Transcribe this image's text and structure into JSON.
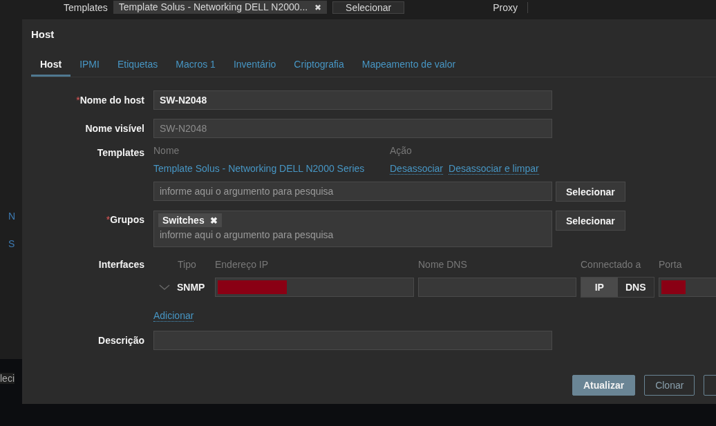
{
  "background": {
    "templates_label": "Templates",
    "template_tag": "Template Solus - Networking DELL N2000...",
    "tag_remove": "✖",
    "select_button": "Selecionar",
    "proxy_label": "Proxy",
    "fragments": [
      "N",
      "S",
      "leci"
    ]
  },
  "dialog": {
    "title": "Host",
    "tabs": [
      {
        "label": "Host",
        "selected": true
      },
      {
        "label": "IPMI",
        "selected": false
      },
      {
        "label": "Etiquetas",
        "selected": false
      },
      {
        "label": "Macros",
        "count": "1",
        "selected": false
      },
      {
        "label": "Inventário",
        "selected": false
      },
      {
        "label": "Criptografia",
        "selected": false
      },
      {
        "label": "Mapeamento de valor",
        "selected": false
      }
    ],
    "required_mark": "*",
    "host_name": {
      "label": "Nome do host",
      "required": true,
      "value": "SW-N2048"
    },
    "visible_name": {
      "label": "Nome visível",
      "value": "SW-N2048"
    },
    "templates": {
      "label": "Templates",
      "columns": [
        "Nome",
        "Ação"
      ],
      "rows": [
        {
          "name": "Template Solus - Networking DELL N2000 Series",
          "actions": [
            "Desassociar",
            "Desassociar e limpar"
          ]
        }
      ],
      "search_placeholder": "informe aqui o argumento para pesquisa",
      "select_button": "Selecionar"
    },
    "groups": {
      "label": "Grupos",
      "required": true,
      "tags": [
        {
          "label": "Switches",
          "remove": "✖"
        }
      ],
      "search_placeholder": "informe aqui o argumento para pesquisa",
      "select_button": "Selecionar"
    },
    "interfaces": {
      "label": "Interfaces",
      "columns": [
        "Tipo",
        "Endereço IP",
        "Nome DNS",
        "Connectado a",
        "Porta"
      ],
      "rows": [
        {
          "type": "SNMP",
          "expanded": false,
          "ip_redacted": true,
          "dns": "",
          "connect": [
            {
              "label": "IP",
              "selected": true
            },
            {
              "label": "DNS",
              "selected": false
            }
          ],
          "port_redacted": true
        }
      ],
      "add_link": "Adicionar"
    },
    "description": {
      "label": "Descrição"
    },
    "buttons": [
      {
        "label": "Atualizar",
        "kind": "primary"
      },
      {
        "label": "Clonar",
        "kind": "secondary"
      },
      {
        "kind": "cut"
      }
    ]
  }
}
